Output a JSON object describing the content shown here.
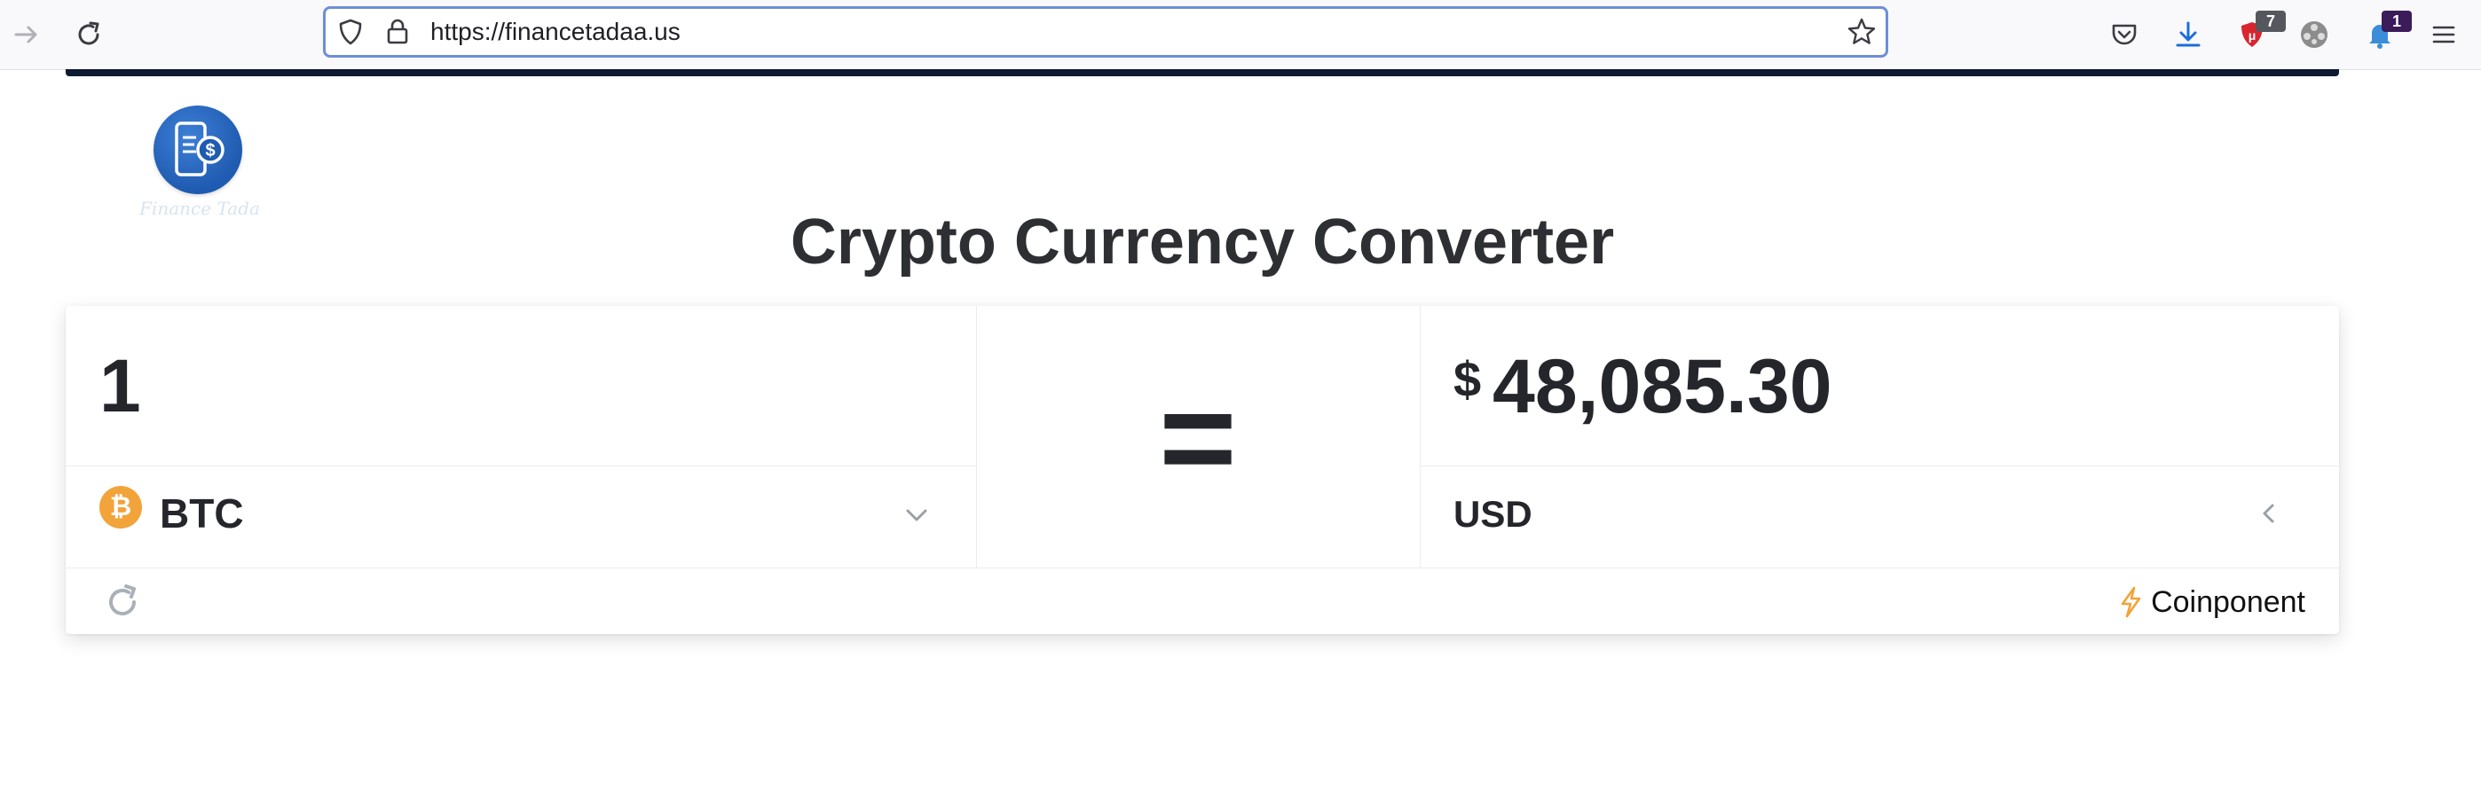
{
  "browser": {
    "url": "https://financetadaa.us",
    "extensions": [
      {
        "name": "pocket",
        "badge": ""
      },
      {
        "name": "downloads",
        "badge": ""
      },
      {
        "name": "ublock",
        "badge": "7"
      },
      {
        "name": "extension-grey",
        "badge": ""
      },
      {
        "name": "extension-notify",
        "badge": "1"
      }
    ]
  },
  "logo": {
    "text": "Finance Tada"
  },
  "page": {
    "title": "Crypto Currency Converter"
  },
  "converter": {
    "from_amount": "1",
    "from_currency": "BTC",
    "equals_sign": "=",
    "to_symbol": "$",
    "to_amount": "48,085.30",
    "to_currency": "USD",
    "brand": "Coinponent"
  },
  "colors": {
    "accent_focus": "#6d8ed8",
    "btc_orange": "#f2a33a",
    "logo_blue": "#1f5bb0",
    "ublock_red": "#d9252f",
    "notify_badge": "#3b1b5a"
  }
}
